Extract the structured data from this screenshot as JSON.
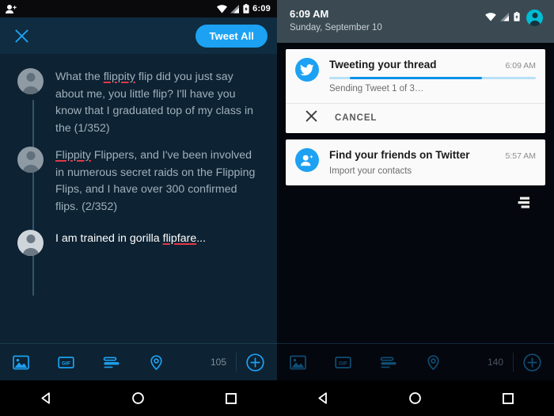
{
  "left": {
    "statusbar": {
      "time": "6:09",
      "icons": [
        "person-add-icon",
        "wifi-icon",
        "signal-icon",
        "battery-charging-icon"
      ]
    },
    "compose_header": {
      "close_label": "✕",
      "tweet_all_label": "Tweet All"
    },
    "thread": [
      {
        "text_before": "What the ",
        "misspelled": "flippity",
        "text_after": " flip did you just say about me, you little flip? I'll have you know that I graduated top of my class in the (1/352)",
        "state": "draft"
      },
      {
        "text_before": "",
        "misspelled": "Flippity",
        "text_after": " Flippers, and I've been involved in numerous secret raids on the Flipping Flips, and I have over 300 confirmed flips. (2/352)",
        "state": "draft"
      },
      {
        "text_before": "I am trained in gorilla ",
        "misspelled": "flipfare",
        "text_after": "...",
        "state": "active"
      }
    ],
    "toolbar": {
      "icons": [
        "image-icon",
        "gif-icon",
        "poll-icon",
        "location-icon"
      ],
      "char_count": "105",
      "add_label": "+"
    },
    "navbar": {
      "back": "back-button",
      "home": "home-button",
      "recents": "recents-button"
    }
  },
  "right": {
    "shade": {
      "clock": "6:09 AM",
      "date": "Sunday, September 10",
      "icons": [
        "wifi-icon",
        "signal-icon",
        "battery-charging-icon",
        "user-avatar"
      ]
    },
    "notifications": [
      {
        "icon": "twitter-bird-icon",
        "title": "Tweeting your thread",
        "time": "6:09 AM",
        "subtitle": "Sending Tweet 1 of 3…",
        "progress": true,
        "progress_start_pct": 10,
        "progress_width_pct": 64,
        "action_icon": "close-icon",
        "action_label": "CANCEL"
      },
      {
        "icon": "person-add-icon",
        "title": "Find your friends on Twitter",
        "time": "5:57 AM",
        "subtitle": "Import your contacts",
        "progress": false
      }
    ],
    "clear_all": "clear-all-notifications-icon",
    "toolbar": {
      "icons": [
        "image-icon",
        "gif-icon",
        "poll-icon",
        "location-icon"
      ],
      "char_count": "140",
      "add_label": "+"
    },
    "navbar": {
      "back": "back-button",
      "home": "home-button",
      "recents": "recents-button"
    }
  },
  "colors": {
    "twitter_blue": "#1da1f2",
    "compose_bg": "#0d2232",
    "compose_header_bg": "#0f2c40",
    "shade_bg": "#3b4a52",
    "shade_right_bg": "#04070d",
    "progress_active": "#0091ea",
    "progress_track": "#b8e1f7",
    "misspell_underline": "#e0384a",
    "draft_text": "#9fb0bc",
    "active_text": "#ffffff"
  }
}
